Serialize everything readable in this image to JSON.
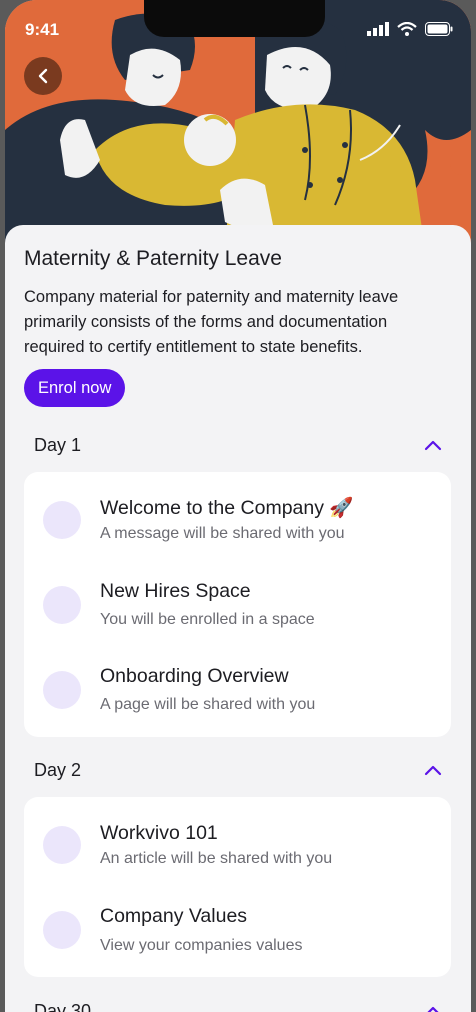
{
  "status_bar": {
    "time": "9:41"
  },
  "header": {
    "title": "Maternity & Paternity Leave"
  },
  "course": {
    "description": "Company material for paternity and maternity leave primarily consists of the forms and documentation required to certify entitlement to state benefits.",
    "enrol_label": "Enrol now"
  },
  "days": [
    {
      "label": "Day 1",
      "items": [
        {
          "title": "Welcome to the Company 🚀",
          "subtitle": "A message will be shared with you"
        },
        {
          "title": "New Hires Space",
          "subtitle": "You will be enrolled in a space"
        },
        {
          "title": "Onboarding Overview",
          "subtitle": "A page will be shared with you"
        }
      ]
    },
    {
      "label": "Day 2",
      "items": [
        {
          "title": "Workvivo 101",
          "subtitle": "An article will be shared with you"
        },
        {
          "title": "Company Values",
          "subtitle": "View your companies values"
        }
      ]
    },
    {
      "label": "Day 30"
    }
  ],
  "colors": {
    "accent": "#5b13e8",
    "hero_bg": "#e06a3b",
    "dot": "#ebe6fb"
  }
}
